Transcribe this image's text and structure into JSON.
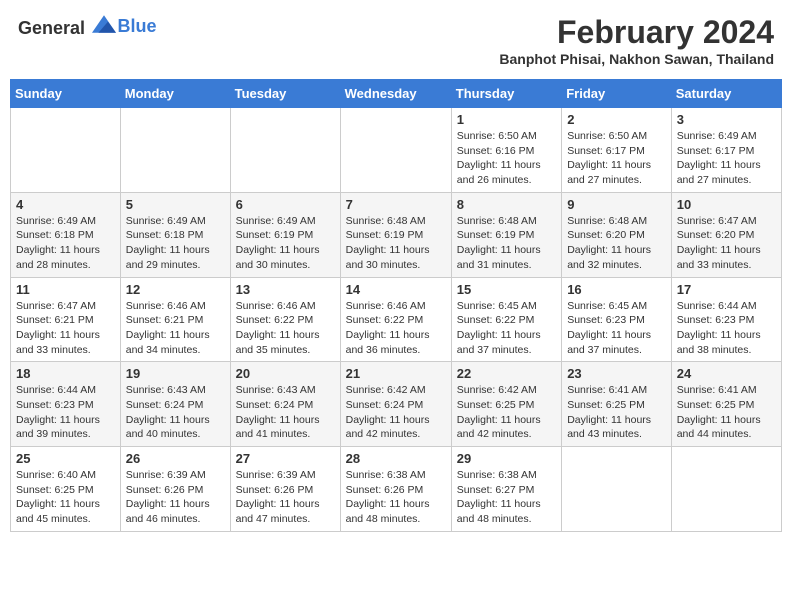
{
  "header": {
    "logo_general": "General",
    "logo_blue": "Blue",
    "month_year": "February 2024",
    "location": "Banphot Phisai, Nakhon Sawan, Thailand"
  },
  "weekdays": [
    "Sunday",
    "Monday",
    "Tuesday",
    "Wednesday",
    "Thursday",
    "Friday",
    "Saturday"
  ],
  "weeks": [
    [
      {
        "day": "",
        "info": ""
      },
      {
        "day": "",
        "info": ""
      },
      {
        "day": "",
        "info": ""
      },
      {
        "day": "",
        "info": ""
      },
      {
        "day": "1",
        "info": "Sunrise: 6:50 AM\nSunset: 6:16 PM\nDaylight: 11 hours and 26 minutes."
      },
      {
        "day": "2",
        "info": "Sunrise: 6:50 AM\nSunset: 6:17 PM\nDaylight: 11 hours and 27 minutes."
      },
      {
        "day": "3",
        "info": "Sunrise: 6:49 AM\nSunset: 6:17 PM\nDaylight: 11 hours and 27 minutes."
      }
    ],
    [
      {
        "day": "4",
        "info": "Sunrise: 6:49 AM\nSunset: 6:18 PM\nDaylight: 11 hours and 28 minutes."
      },
      {
        "day": "5",
        "info": "Sunrise: 6:49 AM\nSunset: 6:18 PM\nDaylight: 11 hours and 29 minutes."
      },
      {
        "day": "6",
        "info": "Sunrise: 6:49 AM\nSunset: 6:19 PM\nDaylight: 11 hours and 30 minutes."
      },
      {
        "day": "7",
        "info": "Sunrise: 6:48 AM\nSunset: 6:19 PM\nDaylight: 11 hours and 30 minutes."
      },
      {
        "day": "8",
        "info": "Sunrise: 6:48 AM\nSunset: 6:19 PM\nDaylight: 11 hours and 31 minutes."
      },
      {
        "day": "9",
        "info": "Sunrise: 6:48 AM\nSunset: 6:20 PM\nDaylight: 11 hours and 32 minutes."
      },
      {
        "day": "10",
        "info": "Sunrise: 6:47 AM\nSunset: 6:20 PM\nDaylight: 11 hours and 33 minutes."
      }
    ],
    [
      {
        "day": "11",
        "info": "Sunrise: 6:47 AM\nSunset: 6:21 PM\nDaylight: 11 hours and 33 minutes."
      },
      {
        "day": "12",
        "info": "Sunrise: 6:46 AM\nSunset: 6:21 PM\nDaylight: 11 hours and 34 minutes."
      },
      {
        "day": "13",
        "info": "Sunrise: 6:46 AM\nSunset: 6:22 PM\nDaylight: 11 hours and 35 minutes."
      },
      {
        "day": "14",
        "info": "Sunrise: 6:46 AM\nSunset: 6:22 PM\nDaylight: 11 hours and 36 minutes."
      },
      {
        "day": "15",
        "info": "Sunrise: 6:45 AM\nSunset: 6:22 PM\nDaylight: 11 hours and 37 minutes."
      },
      {
        "day": "16",
        "info": "Sunrise: 6:45 AM\nSunset: 6:23 PM\nDaylight: 11 hours and 37 minutes."
      },
      {
        "day": "17",
        "info": "Sunrise: 6:44 AM\nSunset: 6:23 PM\nDaylight: 11 hours and 38 minutes."
      }
    ],
    [
      {
        "day": "18",
        "info": "Sunrise: 6:44 AM\nSunset: 6:23 PM\nDaylight: 11 hours and 39 minutes."
      },
      {
        "day": "19",
        "info": "Sunrise: 6:43 AM\nSunset: 6:24 PM\nDaylight: 11 hours and 40 minutes."
      },
      {
        "day": "20",
        "info": "Sunrise: 6:43 AM\nSunset: 6:24 PM\nDaylight: 11 hours and 41 minutes."
      },
      {
        "day": "21",
        "info": "Sunrise: 6:42 AM\nSunset: 6:24 PM\nDaylight: 11 hours and 42 minutes."
      },
      {
        "day": "22",
        "info": "Sunrise: 6:42 AM\nSunset: 6:25 PM\nDaylight: 11 hours and 42 minutes."
      },
      {
        "day": "23",
        "info": "Sunrise: 6:41 AM\nSunset: 6:25 PM\nDaylight: 11 hours and 43 minutes."
      },
      {
        "day": "24",
        "info": "Sunrise: 6:41 AM\nSunset: 6:25 PM\nDaylight: 11 hours and 44 minutes."
      }
    ],
    [
      {
        "day": "25",
        "info": "Sunrise: 6:40 AM\nSunset: 6:25 PM\nDaylight: 11 hours and 45 minutes."
      },
      {
        "day": "26",
        "info": "Sunrise: 6:39 AM\nSunset: 6:26 PM\nDaylight: 11 hours and 46 minutes."
      },
      {
        "day": "27",
        "info": "Sunrise: 6:39 AM\nSunset: 6:26 PM\nDaylight: 11 hours and 47 minutes."
      },
      {
        "day": "28",
        "info": "Sunrise: 6:38 AM\nSunset: 6:26 PM\nDaylight: 11 hours and 48 minutes."
      },
      {
        "day": "29",
        "info": "Sunrise: 6:38 AM\nSunset: 6:27 PM\nDaylight: 11 hours and 48 minutes."
      },
      {
        "day": "",
        "info": ""
      },
      {
        "day": "",
        "info": ""
      }
    ]
  ]
}
